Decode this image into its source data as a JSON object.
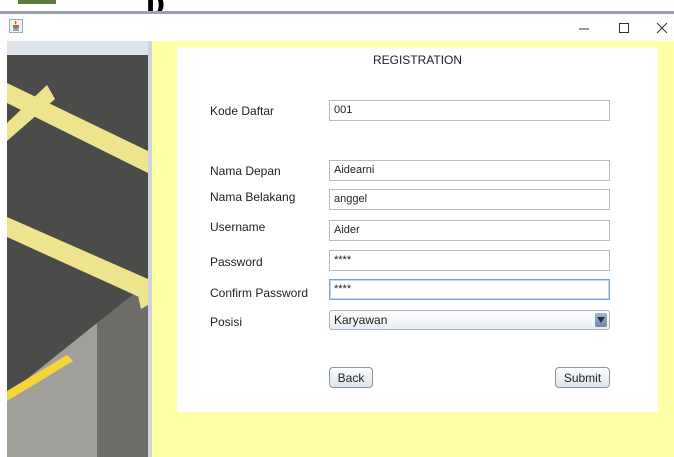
{
  "window": {
    "icon": "java-coffee-icon",
    "controls": {
      "minimize": "–",
      "maximize": "☐",
      "close": "✕"
    }
  },
  "form": {
    "title": "REGISTRATION",
    "fields": [
      {
        "label": "Kode Daftar",
        "value": "001"
      },
      {
        "label": "Nama Depan",
        "value": "Aidearni"
      },
      {
        "label": "Nama Belakang",
        "value": "anggel"
      },
      {
        "label": "Username",
        "value": "Aider"
      },
      {
        "label": "Password",
        "value": "****"
      },
      {
        "label": "Confirm Password",
        "value": "****"
      }
    ],
    "posisi": {
      "label": "Posisi",
      "selected": "Karyawan"
    },
    "buttons": {
      "back": "Back",
      "submit": "Submit"
    }
  },
  "colors": {
    "background_yellow": "#ffffa6",
    "panel_white": "#ffffff",
    "parking_lines": "#f2e68a",
    "asphalt": "#4a4a48"
  },
  "left_image": "parking-lot-photo"
}
